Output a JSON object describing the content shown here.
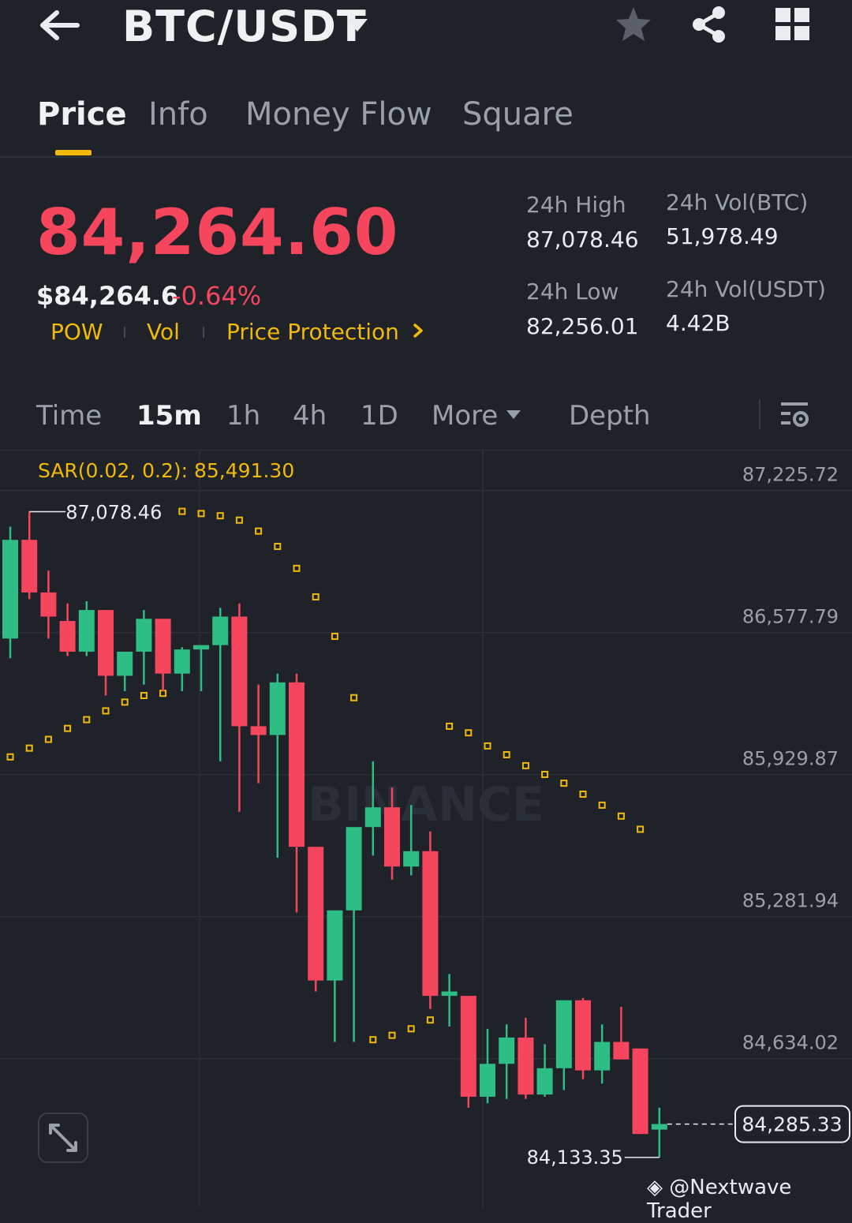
{
  "header": {
    "pair": "BTC/USDT",
    "icons": [
      "back-arrow-icon",
      "caret-down-icon",
      "star-icon",
      "share-icon",
      "grid-icon"
    ]
  },
  "tabs": [
    {
      "label": "Price",
      "active": true
    },
    {
      "label": "Info",
      "active": false
    },
    {
      "label": "Money Flow",
      "active": false
    },
    {
      "label": "Square",
      "active": false
    }
  ],
  "price": {
    "last": "84,264.60",
    "usd": "$84,264.6",
    "change": "-0.64%",
    "tags": [
      "POW",
      "Vol",
      "Price Protection"
    ]
  },
  "stats": {
    "high_label": "24h High",
    "high_value": "87,078.46",
    "low_label": "24h Low",
    "low_value": "82,256.01",
    "vol_btc_label": "24h Vol(BTC)",
    "vol_btc_value": "51,978.49",
    "vol_usdt_label": "24h Vol(USDT)",
    "vol_usdt_value": "4.42B"
  },
  "intervals": [
    "Time",
    "15m",
    "1h",
    "4h",
    "1D",
    "More",
    "Depth"
  ],
  "active_interval": "15m",
  "colors": {
    "up": "#2ebd85",
    "down": "#f6465d",
    "accent": "#f0b90b",
    "bg": "#1f2229"
  },
  "chart_data": {
    "type": "candlestick",
    "indicator": "SAR(0.02, 0.2): 85,491.30",
    "y_ticks": [
      "87,225.72",
      "86,577.79",
      "85,929.87",
      "85,281.94",
      "84,634.02"
    ],
    "y_tick_values": [
      87225.72,
      86577.79,
      85929.87,
      85281.94,
      84634.02
    ],
    "ylim": [
      84000,
      87400
    ],
    "high_marker": "87,078.46",
    "low_marker": "84,133.35",
    "current_price": "84,285.33",
    "watermark": "BINANCE",
    "candles": [
      {
        "o": 86500,
        "h": 87010,
        "l": 86410,
        "c": 86950
      },
      {
        "o": 86950,
        "h": 87078.46,
        "l": 86680,
        "c": 86710
      },
      {
        "o": 86710,
        "h": 86810,
        "l": 86500,
        "c": 86600
      },
      {
        "o": 86580,
        "h": 86660,
        "l": 86420,
        "c": 86440
      },
      {
        "o": 86440,
        "h": 86670,
        "l": 86420,
        "c": 86630
      },
      {
        "o": 86630,
        "h": 86630,
        "l": 86240,
        "c": 86330
      },
      {
        "o": 86330,
        "h": 86420,
        "l": 86260,
        "c": 86440
      },
      {
        "o": 86440,
        "h": 86630,
        "l": 86290,
        "c": 86590
      },
      {
        "o": 86590,
        "h": 86590,
        "l": 86260,
        "c": 86340
      },
      {
        "o": 86340,
        "h": 86460,
        "l": 86260,
        "c": 86450
      },
      {
        "o": 86450,
        "h": 86470,
        "l": 86260,
        "c": 86470
      },
      {
        "o": 86470,
        "h": 86640,
        "l": 85940,
        "c": 86600
      },
      {
        "o": 86600,
        "h": 86660,
        "l": 85710,
        "c": 86100
      },
      {
        "o": 86100,
        "h": 86290,
        "l": 85840,
        "c": 86060
      },
      {
        "o": 86060,
        "h": 86340,
        "l": 85500,
        "c": 86300
      },
      {
        "o": 86300,
        "h": 86340,
        "l": 85250,
        "c": 85550
      },
      {
        "o": 85550,
        "h": 85550,
        "l": 84890,
        "c": 84940
      },
      {
        "o": 84940,
        "h": 84960,
        "l": 84660,
        "c": 85260
      },
      {
        "o": 85260,
        "h": 85640,
        "l": 84660,
        "c": 85640
      },
      {
        "o": 85640,
        "h": 85940,
        "l": 85510,
        "c": 85730
      },
      {
        "o": 85730,
        "h": 85820,
        "l": 85400,
        "c": 85460
      },
      {
        "o": 85460,
        "h": 85740,
        "l": 85420,
        "c": 85530
      },
      {
        "o": 85530,
        "h": 85620,
        "l": 84810,
        "c": 84870
      },
      {
        "o": 84870,
        "h": 84970,
        "l": 84730,
        "c": 84890
      },
      {
        "o": 84870,
        "h": 84860,
        "l": 84360,
        "c": 84410
      },
      {
        "o": 84410,
        "h": 84720,
        "l": 84380,
        "c": 84560
      },
      {
        "o": 84560,
        "h": 84740,
        "l": 84400,
        "c": 84680
      },
      {
        "o": 84680,
        "h": 84770,
        "l": 84400,
        "c": 84420
      },
      {
        "o": 84420,
        "h": 84650,
        "l": 84410,
        "c": 84540
      },
      {
        "o": 84540,
        "h": 84840,
        "l": 84440,
        "c": 84850
      },
      {
        "o": 84850,
        "h": 84860,
        "l": 84490,
        "c": 84530
      },
      {
        "o": 84530,
        "h": 84740,
        "l": 84470,
        "c": 84660
      },
      {
        "o": 84660,
        "h": 84820,
        "l": 84580,
        "c": 84580
      },
      {
        "o": 84630,
        "h": 84630,
        "l": 84240,
        "c": 84240
      },
      {
        "o": 84260,
        "h": 84360,
        "l": 84133.35,
        "c": 84285.33
      }
    ],
    "sar": [
      {
        "i": 0,
        "v": 85960
      },
      {
        "i": 1,
        "v": 86000
      },
      {
        "i": 2,
        "v": 86040
      },
      {
        "i": 3,
        "v": 86090
      },
      {
        "i": 4,
        "v": 86130
      },
      {
        "i": 5,
        "v": 86170
      },
      {
        "i": 6,
        "v": 86210
      },
      {
        "i": 7,
        "v": 86240
      },
      {
        "i": 8,
        "v": 86250
      },
      {
        "i": 9,
        "v": 87080
      },
      {
        "i": 10,
        "v": 87070
      },
      {
        "i": 11,
        "v": 87060
      },
      {
        "i": 12,
        "v": 87040
      },
      {
        "i": 13,
        "v": 86990
      },
      {
        "i": 14,
        "v": 86920
      },
      {
        "i": 15,
        "v": 86820
      },
      {
        "i": 16,
        "v": 86690
      },
      {
        "i": 17,
        "v": 86510
      },
      {
        "i": 18,
        "v": 86230
      },
      {
        "i": 19,
        "v": 84670
      },
      {
        "i": 20,
        "v": 84690
      },
      {
        "i": 21,
        "v": 84720
      },
      {
        "i": 22,
        "v": 84760
      },
      {
        "i": 23,
        "v": 86100
      },
      {
        "i": 24,
        "v": 86070
      },
      {
        "i": 25,
        "v": 86010
      },
      {
        "i": 26,
        "v": 85970
      },
      {
        "i": 27,
        "v": 85920
      },
      {
        "i": 28,
        "v": 85880
      },
      {
        "i": 29,
        "v": 85840
      },
      {
        "i": 30,
        "v": 85790
      },
      {
        "i": 31,
        "v": 85740
      },
      {
        "i": 32,
        "v": 85690
      },
      {
        "i": 33,
        "v": 85630
      }
    ]
  }
}
